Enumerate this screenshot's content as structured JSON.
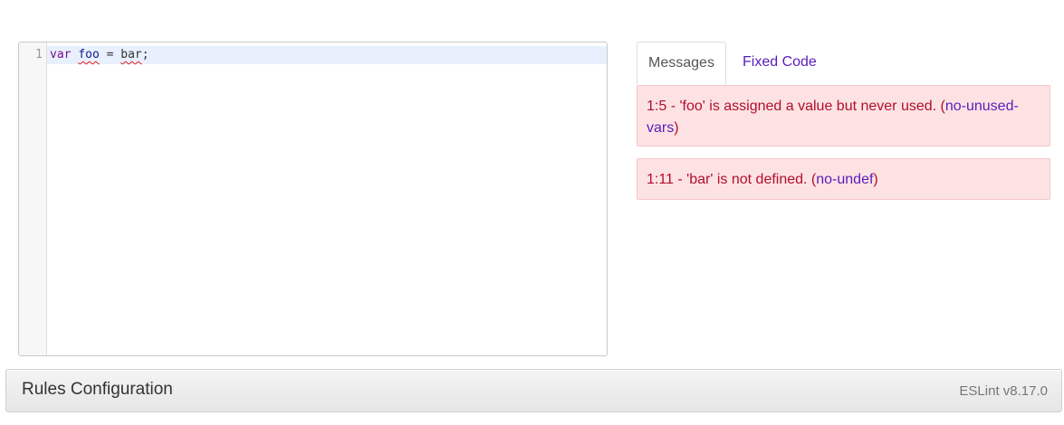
{
  "editor": {
    "line_number": "1",
    "code": {
      "keyword": "var",
      "variable": "foo",
      "operator": " = ",
      "value": "bar",
      "terminator": ";"
    }
  },
  "tabs": {
    "messages_label": "Messages",
    "fixed_code_label": "Fixed Code"
  },
  "messages": [
    {
      "text": "1:5 - 'foo' is assigned a value but never used. (",
      "rule": "no-unused-vars",
      "close": ")"
    },
    {
      "text": "1:11 - 'bar' is not defined. (",
      "rule": "no-undef",
      "close": ")"
    }
  ],
  "footer": {
    "title": "Rules Configuration",
    "version": "ESLint v8.17.0"
  },
  "colors": {
    "accent": "#5a1db8",
    "error_text": "#b0102a",
    "error_bg": "#fde2e4"
  }
}
